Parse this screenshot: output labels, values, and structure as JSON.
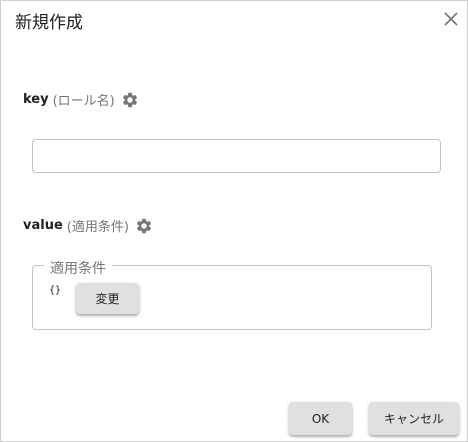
{
  "dialog": {
    "title": "新規作成",
    "close_icon": "close-icon"
  },
  "key_field": {
    "label": "key",
    "sub_label": "(ロール名)",
    "icon": "gear-icon",
    "value": "",
    "placeholder": ""
  },
  "value_field": {
    "label": "value",
    "sub_label": "(適用条件)",
    "icon": "gear-icon",
    "group_legend": "適用条件",
    "current_value": "{}",
    "change_button": "変更"
  },
  "footer": {
    "ok_label": "OK",
    "cancel_label": "キャンセル"
  },
  "colors": {
    "button_bg": "#e0e0e0",
    "icon_gray": "#757575",
    "border": "#c4c4c4"
  }
}
